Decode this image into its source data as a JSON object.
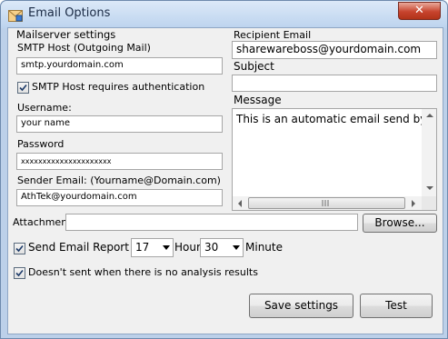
{
  "window": {
    "title": "Email Options",
    "close_label": "✕"
  },
  "mailserver": {
    "group_title": "Mailserver settings",
    "smtp_label": "SMTP Host (Outgoing Mail)",
    "smtp_value": "smtp.yourdomain.com",
    "auth_label": "SMTP Host requires authentication",
    "auth_checked": true,
    "username_label": "Username:",
    "username_value": "your name",
    "password_label": "Password",
    "password_value": "xxxxxxxxxxxxxxxxxxxxx",
    "sender_label": "Sender Email: (Yourname@Domain.com)",
    "sender_value": "AthTek@yourdomain.com"
  },
  "recipient": {
    "label": "Recipient Email",
    "value": "sharewareboss@yourdomain.com",
    "subject_label": "Subject",
    "subject_value": "",
    "message_label": "Message",
    "message_value": "This is an automatic email send by AI"
  },
  "attachment": {
    "label": "Attachment",
    "value": "",
    "browse_label": "Browse..."
  },
  "report": {
    "send_label": "Send Email Report",
    "send_checked": true,
    "hour_value": "17",
    "hour_label": "Hour",
    "minute_value": "30",
    "minute_label": "Minute",
    "no_analysis_label": "Doesn't sent when there is no analysis results",
    "no_analysis_checked": true
  },
  "buttons": {
    "save_label": "Save settings",
    "test_label": "Test"
  },
  "icons": {
    "app": "email-options-icon",
    "check": "check-icon",
    "arrow": "chevron-down-icon"
  }
}
